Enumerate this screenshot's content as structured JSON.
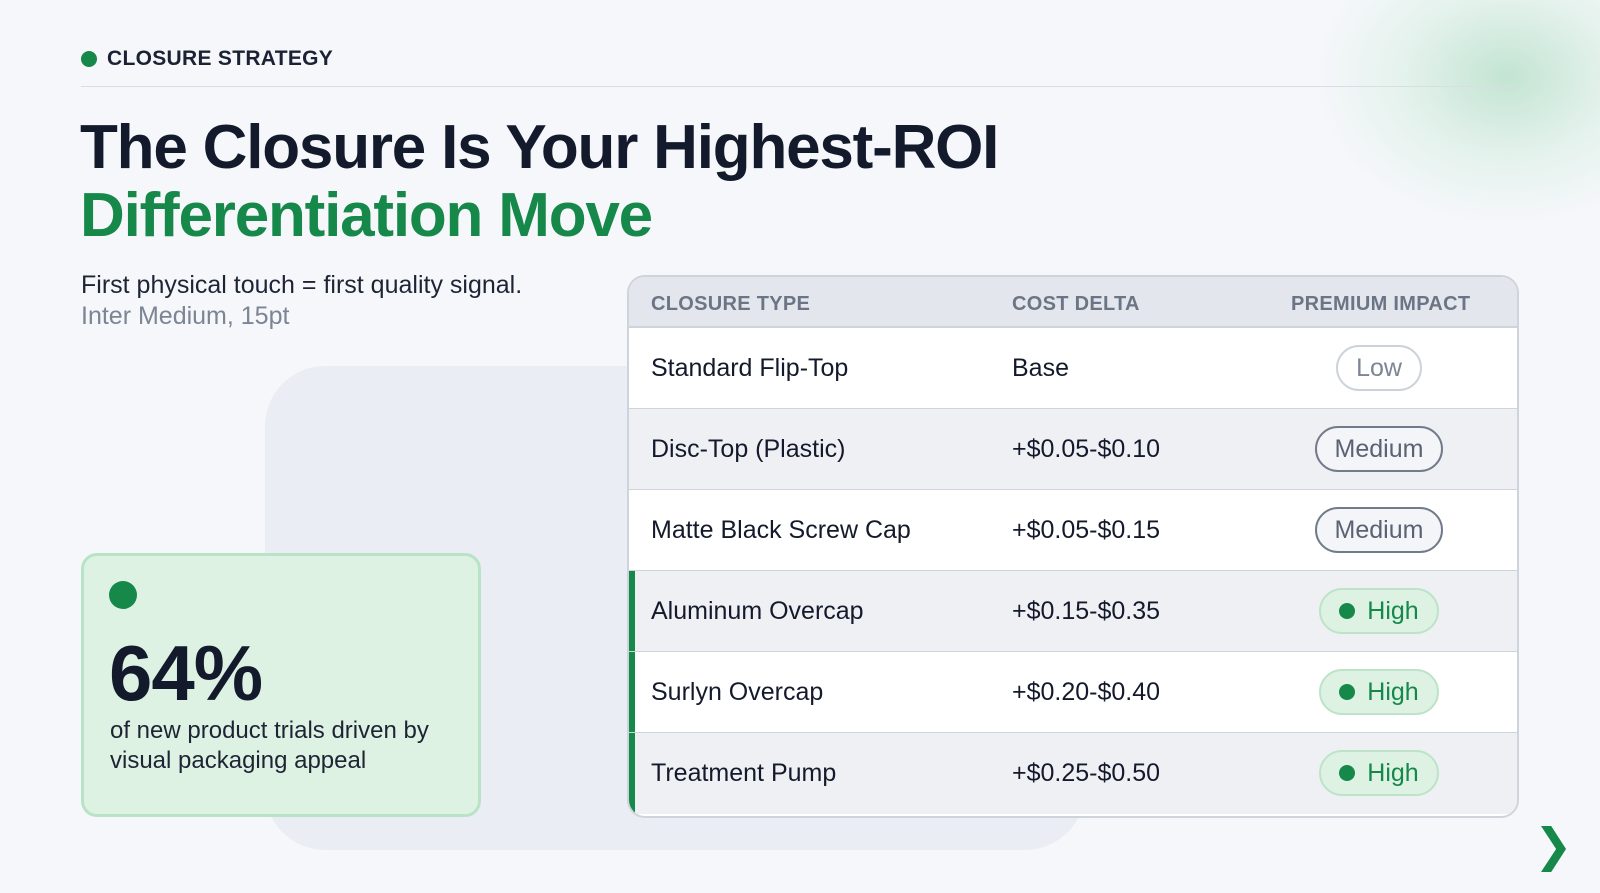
{
  "eyebrow": "CLOSURE STRATEGY",
  "title": {
    "line1": "The Closure Is Your Highest-ROI",
    "line2": "Differentiation Move"
  },
  "subtitle": {
    "line1": "First physical touch = first quality signal.",
    "line2": "Inter Medium, 15pt"
  },
  "stat": {
    "value": "64%",
    "caption": "of new product trials driven by visual packaging appeal"
  },
  "table": {
    "headers": [
      "CLOSURE TYPE",
      "COST DELTA",
      "PREMIUM IMPACT"
    ],
    "rows": [
      {
        "type": "Standard Flip-Top",
        "cost": "Base",
        "impact": "Low"
      },
      {
        "type": "Disc-Top (Plastic)",
        "cost": "+$0.05-$0.10",
        "impact": "Medium"
      },
      {
        "type": "Matte Black Screw Cap",
        "cost": "+$0.05-$0.15",
        "impact": "Medium"
      },
      {
        "type": "Aluminum Overcap",
        "cost": "+$0.15-$0.35",
        "impact": "High"
      },
      {
        "type": "Surlyn Overcap",
        "cost": "+$0.20-$0.40",
        "impact": "High"
      },
      {
        "type": "Treatment Pump",
        "cost": "+$0.25-$0.50",
        "impact": "High"
      }
    ]
  },
  "next_icon": "chevron-right-icon",
  "colors": {
    "accent": "#15884a",
    "text": "#141a2b",
    "muted": "#7b8594"
  }
}
